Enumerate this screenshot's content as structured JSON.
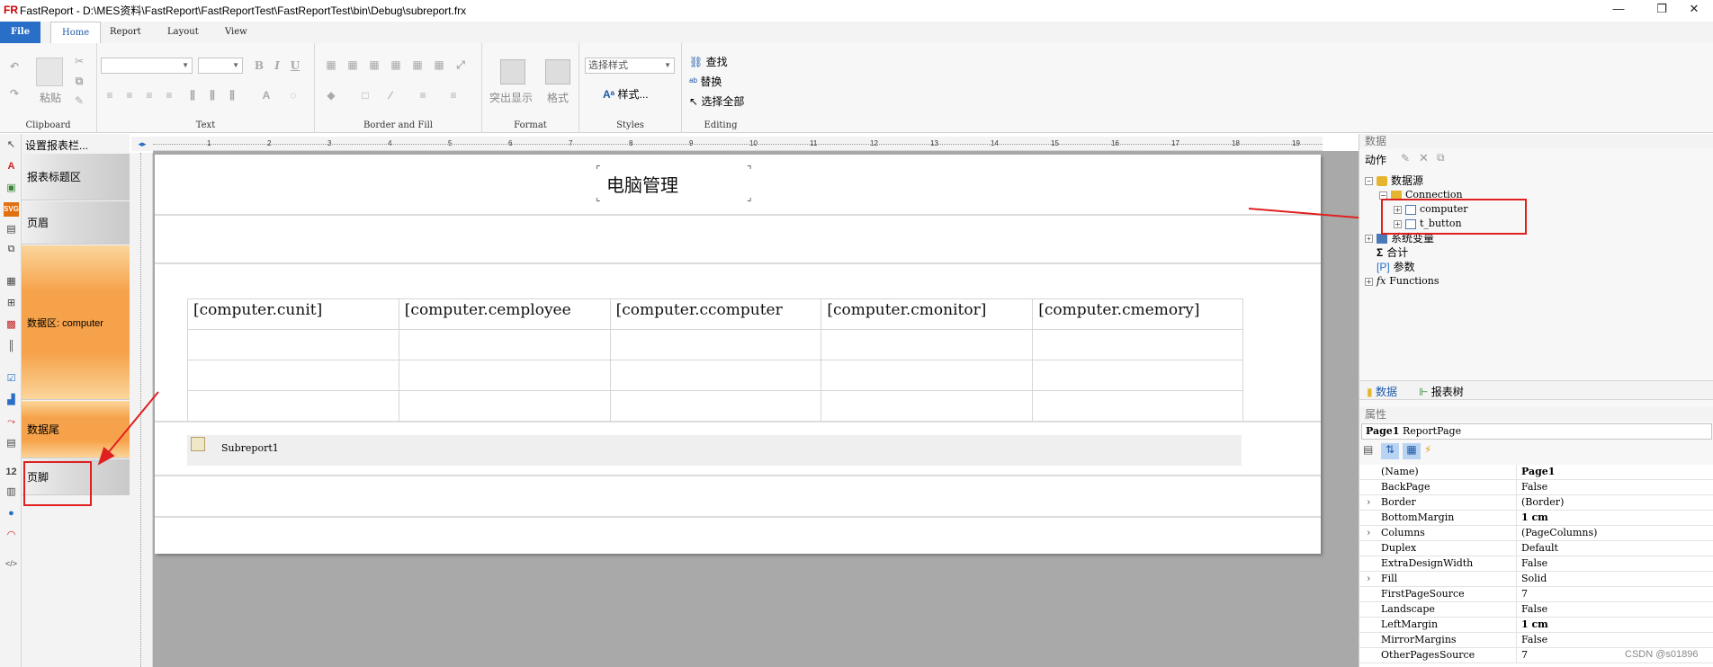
{
  "window": {
    "title": "FastReport - D:\\MES资料\\FastReport\\FastReportTest\\FastReportTest\\bin\\Debug\\subreport.frx",
    "logo": "FR",
    "minimize": "—",
    "restore": "❐",
    "close": "✕"
  },
  "tabs": [
    {
      "label": "File"
    },
    {
      "label": "Home"
    },
    {
      "label": "Report"
    },
    {
      "label": "Layout"
    },
    {
      "label": "View"
    }
  ],
  "ribbon": {
    "clipboard": {
      "label": "Clipboard",
      "paste": "粘贴"
    },
    "text": {
      "label": "Text",
      "font_name": "",
      "font_size": "",
      "bold": "B",
      "italic": "I",
      "underline": "U"
    },
    "border": {
      "label": "Border and Fill"
    },
    "format": {
      "label": "Format",
      "highlight": "突出显示",
      "format": "格式"
    },
    "styles": {
      "label": "Styles",
      "combo": "选择样式",
      "styles_btn": "样式..."
    },
    "editing": {
      "label": "Editing",
      "find": "查找",
      "replace": "替换",
      "select_all": "选择全部"
    }
  },
  "left_tools": [
    "pointer-icon",
    "text-icon",
    "picture-icon",
    "svg-icon",
    "band-icon",
    "subreport-icon",
    "table-icon",
    "matrix-icon",
    "chart-icon",
    "barcode-icon",
    "checkbox-icon",
    "sparkline-icon",
    "gauge-icon",
    "number-icon",
    "richtext-icon",
    "map-icon",
    "dial-icon",
    "code-icon"
  ],
  "band_tree": {
    "header": "设置报表栏...",
    "bands": [
      {
        "label": "报表标题区"
      },
      {
        "label": "页眉"
      },
      {
        "label": "数据区: computer"
      },
      {
        "label": "数据尾"
      },
      {
        "label": "页脚"
      }
    ]
  },
  "ruler": {
    "marks": [
      "1",
      "2",
      "3",
      "4",
      "5",
      "6",
      "7",
      "8",
      "9",
      "10",
      "11",
      "12",
      "13",
      "14",
      "15",
      "16",
      "17",
      "18",
      "19"
    ]
  },
  "report": {
    "title": "电脑管理",
    "columns": [
      "[computer.cunit]",
      "[computer.cemployee",
      "[computer.ccomputer",
      "[computer.cmonitor]",
      "[computer.cmemory]"
    ],
    "subreport": "Subreport1"
  },
  "data_panel": {
    "header": "数据",
    "action": "动作",
    "tree": [
      {
        "label": "数据源",
        "level": 0,
        "exp": "−"
      },
      {
        "label": "Connection",
        "level": 1,
        "exp": "−"
      },
      {
        "label": "computer",
        "level": 2,
        "exp": "+"
      },
      {
        "label": "t_button",
        "level": 2,
        "exp": "+"
      },
      {
        "label": "系统变量",
        "level": 0,
        "exp": "+"
      },
      {
        "label": "合计",
        "level": 0,
        "exp": ""
      },
      {
        "label": "参数",
        "level": 0,
        "exp": ""
      },
      {
        "label": "Functions",
        "level": 0,
        "exp": "+"
      }
    ],
    "tab_data": "数据",
    "tab_tree": "报表树"
  },
  "properties": {
    "header": "属性",
    "object": "Page1",
    "object_type": "ReportPage",
    "rows": [
      {
        "name": "(Name)",
        "value": "Page1",
        "bold": true,
        "expand": false
      },
      {
        "name": "BackPage",
        "value": "False",
        "bold": false,
        "expand": false
      },
      {
        "name": "Border",
        "value": "(Border)",
        "bold": false,
        "expand": true
      },
      {
        "name": "BottomMargin",
        "value": "1 cm",
        "bold": true,
        "expand": false
      },
      {
        "name": "Columns",
        "value": "(PageColumns)",
        "bold": false,
        "expand": true
      },
      {
        "name": "Duplex",
        "value": "Default",
        "bold": false,
        "expand": false
      },
      {
        "name": "ExtraDesignWidth",
        "value": "False",
        "bold": false,
        "expand": false
      },
      {
        "name": "Fill",
        "value": "Solid",
        "bold": false,
        "expand": true
      },
      {
        "name": "FirstPageSource",
        "value": "7",
        "bold": false,
        "expand": false
      },
      {
        "name": "Landscape",
        "value": "False",
        "bold": false,
        "expand": false
      },
      {
        "name": "LeftMargin",
        "value": "1 cm",
        "bold": true,
        "expand": false
      },
      {
        "name": "MirrorMargins",
        "value": "False",
        "bold": false,
        "expand": false
      },
      {
        "name": "OtherPagesSource",
        "value": "7",
        "bold": false,
        "expand": false
      }
    ]
  },
  "watermark": "CSDN @s01896"
}
